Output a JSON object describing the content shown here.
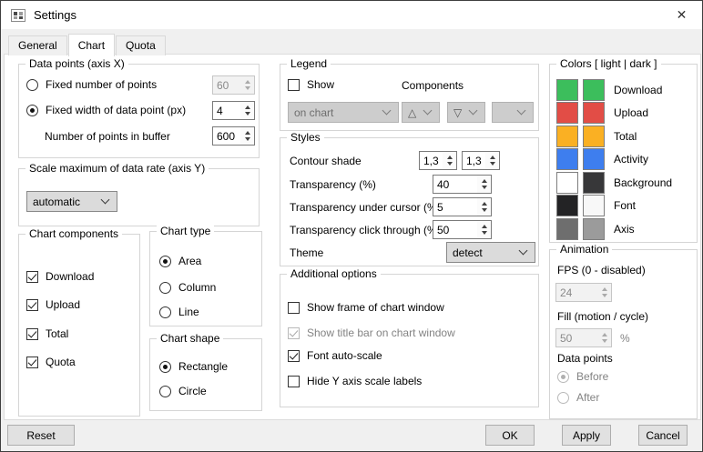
{
  "window": {
    "title": "Settings",
    "close_icon": "✕"
  },
  "tabs": [
    {
      "label": "General",
      "active": false
    },
    {
      "label": "Chart",
      "active": true
    },
    {
      "label": "Quota",
      "active": false
    }
  ],
  "data_points": {
    "title": "Data points (axis X)",
    "fixed_number_label": "Fixed number of points",
    "fixed_number_selected": false,
    "fixed_number_value": "60",
    "fixed_number_disabled": true,
    "fixed_width_label": "Fixed width of data point (px)",
    "fixed_width_selected": true,
    "fixed_width_value": "4",
    "buffer_label": "Number of points in buffer",
    "buffer_value": "600"
  },
  "scale_y": {
    "title": "Scale maximum of data rate (axis Y)",
    "value": "automatic"
  },
  "chart_components": {
    "title": "Chart components",
    "items": [
      {
        "label": "Download",
        "checked": true
      },
      {
        "label": "Upload",
        "checked": true
      },
      {
        "label": "Total",
        "checked": true
      },
      {
        "label": "Quota",
        "checked": true
      }
    ]
  },
  "chart_type": {
    "title": "Chart type",
    "options": [
      {
        "label": "Area",
        "selected": true
      },
      {
        "label": "Column",
        "selected": false
      },
      {
        "label": "Line",
        "selected": false
      }
    ]
  },
  "chart_shape": {
    "title": "Chart shape",
    "options": [
      {
        "label": "Rectangle",
        "selected": true
      },
      {
        "label": "Circle",
        "selected": false
      }
    ]
  },
  "legend": {
    "title": "Legend",
    "show_label": "Show",
    "show_checked": false,
    "components_label": "Components",
    "placement_value": "on chart",
    "placement_disabled": true,
    "marker_up": "△",
    "marker_down": "▽",
    "marker_blank": ""
  },
  "styles": {
    "title": "Styles",
    "contour_label": "Contour shade",
    "contour_value_1": "1,3",
    "contour_value_2": "1,3",
    "transparency_label": "Transparency (%)",
    "transparency_value": "40",
    "under_cursor_label": "Transparency under cursor (%)",
    "under_cursor_value": "5",
    "click_through_label": "Transparency click through (%)",
    "click_through_value": "50",
    "theme_label": "Theme",
    "theme_value": "detect"
  },
  "additional": {
    "title": "Additional options",
    "items": [
      {
        "label": "Show frame of chart window",
        "checked": false,
        "disabled": false
      },
      {
        "label": "Show title bar on chart window",
        "checked": true,
        "disabled": true
      },
      {
        "label": "Font auto-scale",
        "checked": true,
        "disabled": false
      },
      {
        "label": "Hide Y axis scale labels",
        "checked": false,
        "disabled": false
      }
    ]
  },
  "colors": {
    "title": "Colors [ light | dark ]",
    "rows": [
      {
        "label": "Download",
        "light": "#3cbe5c",
        "dark": "#3cbe5c"
      },
      {
        "label": "Upload",
        "light": "#e24d46",
        "dark": "#e24d46"
      },
      {
        "label": "Total",
        "light": "#fab023",
        "dark": "#fab023"
      },
      {
        "label": "Activity",
        "light": "#3e7eee",
        "dark": "#3e7eee"
      },
      {
        "label": "Background",
        "light": "#ffffff",
        "dark": "#373739"
      },
      {
        "label": "Font",
        "light": "#232325",
        "dark": "#f8f8f8"
      },
      {
        "label": "Axis",
        "light": "#6e6e6e",
        "dark": "#9b9b9b"
      }
    ]
  },
  "animation": {
    "title": "Animation",
    "fps_label": "FPS (0 - disabled)",
    "fps_value": "24",
    "fill_label": "Fill (motion / cycle)",
    "fill_value": "50",
    "percent_label": "%",
    "data_points_label": "Data points",
    "options": [
      {
        "label": "Before",
        "selected": true
      },
      {
        "label": "After",
        "selected": false
      }
    ]
  },
  "footer": {
    "reset": "Reset",
    "ok": "OK",
    "apply": "Apply",
    "cancel": "Cancel"
  }
}
